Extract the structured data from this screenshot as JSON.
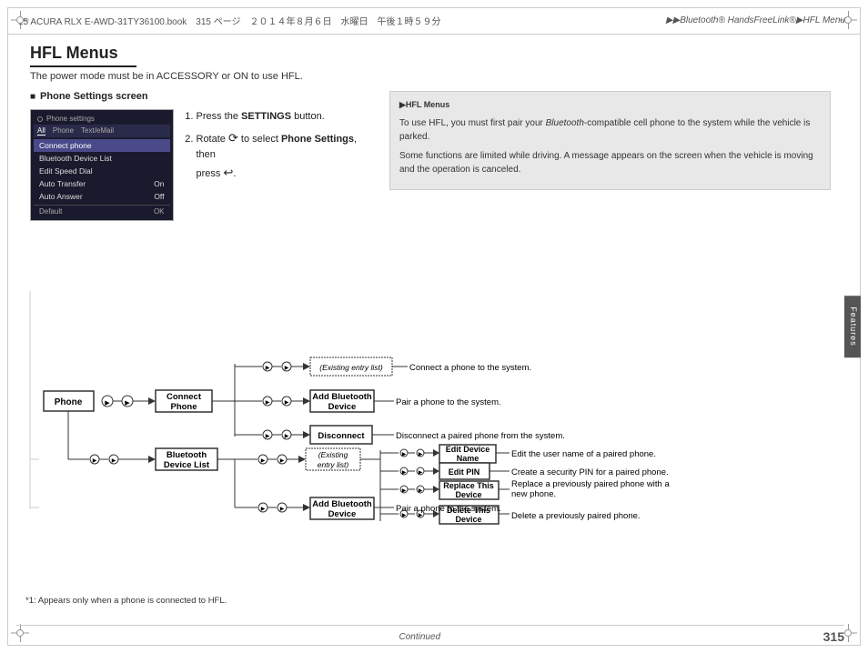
{
  "page": {
    "title": "HFL Menus",
    "subtitle": "The power mode must be in ACCESSORY or ON to use HFL.",
    "page_number": "315",
    "continued_label": "Continued",
    "footnote": "*1: Appears only when a phone is connected to HFL."
  },
  "header": {
    "file_info": "15 ACURA RLX E-AWD-31TY36100.book　315 ページ　２０１４年８月６日　水曜日　午後１時５９分",
    "breadcrumb": "▶▶Bluetooth® HandsFreeLink®▶HFL Menus"
  },
  "right_tab": {
    "label": "Features"
  },
  "section": {
    "phone_settings_heading": "Phone Settings screen"
  },
  "phone_settings_screen": {
    "title": "Phone settings",
    "tabs": [
      "All",
      "Phone",
      "Text/eMail"
    ],
    "items": [
      {
        "label": "Connect phone",
        "selected": true
      },
      {
        "label": "Bluetooth Device List",
        "selected": false
      },
      {
        "label": "Edit Speed Dial",
        "selected": false
      },
      {
        "label": "Auto Transfer",
        "value": "On",
        "selected": false
      },
      {
        "label": "Auto Answer",
        "value": "Off",
        "selected": false
      }
    ],
    "footer_left": "Default",
    "footer_right": "OK"
  },
  "instructions": {
    "step1": "Press the ",
    "step1_bold": "SETTINGS",
    "step1_end": " button.",
    "step2": "Rotate ",
    "step2_end": " to select ",
    "step2_bold": "Phone Settings",
    "step2_final": ", then press"
  },
  "info_box": {
    "header": "▶HFL Menus",
    "para1": "To use HFL, you must first pair your Bluetooth-compatible cell phone to the system while the vehicle is parked.",
    "para2": "Some functions are limited while driving. A message appears on the screen when the vehicle is moving and the operation is canceled."
  },
  "flow": {
    "phone_label": "Phone",
    "connect_phone_label": "Connect\nPhone",
    "existing_entry_list_1": "(Existing entry list)",
    "add_bluetooth_device_1": "Add Bluetooth\nDevice",
    "disconnect_label": "Disconnect",
    "existing_entry_list_2": "(Existing\nentry list)",
    "edit_device_name_label": "Edit Device\nName",
    "edit_pin_label": "Edit PIN",
    "replace_this_device_label": "Replace This\nDevice",
    "delete_this_device_label": "Delete This\nDevice",
    "bluetooth_device_list_label": "Bluetooth\nDevice List",
    "add_bluetooth_device_2": "Add Bluetooth\nDevice",
    "desc_connect_phone": "Connect a phone to the system.",
    "desc_add_bluetooth_1": "Pair a phone to the system.",
    "desc_disconnect": "Disconnect a paired phone from the system.",
    "desc_edit_device_name": "Edit the user name of a paired phone.",
    "desc_edit_pin": "Create a security PIN for a paired phone.",
    "desc_replace_this_device": "Replace a previously paired phone with a new phone.",
    "desc_delete_this_device": "Delete a previously paired phone.",
    "desc_add_bluetooth_2": "Pair a phone to the system."
  }
}
